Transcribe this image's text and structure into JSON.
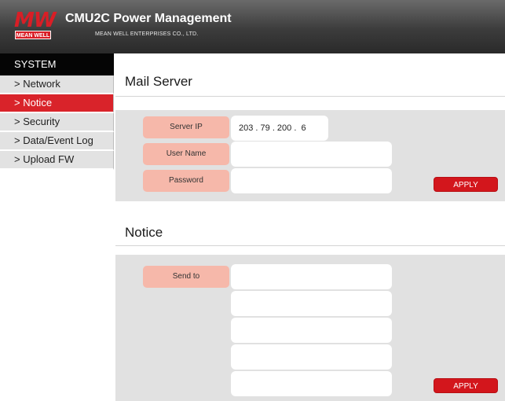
{
  "header": {
    "logo_mark": "MW",
    "logo_sub": "MEAN WELL",
    "title": "CMU2C Power Management",
    "company": "MEAN WELL ENTERPRISES CO., LTD."
  },
  "sidebar": {
    "heading": "SYSTEM",
    "items": [
      {
        "label": "> Network"
      },
      {
        "label": "> Notice"
      },
      {
        "label": "> Security"
      },
      {
        "label": "> Data/Event Log"
      },
      {
        "label": "> Upload FW"
      }
    ],
    "active_index": 1
  },
  "mail_server": {
    "title": "Mail Server",
    "server_ip_label": "Server IP",
    "server_ip_value": "203 . 79 . 200 .  6",
    "user_name_label": "User Name",
    "user_name_value": "",
    "password_label": "Password",
    "password_value": "",
    "apply_label": "APPLY"
  },
  "notice": {
    "title": "Notice",
    "send_to_label": "Send to",
    "send_to_values": [
      "",
      "",
      "",
      "",
      ""
    ],
    "apply_label": "APPLY"
  },
  "colors": {
    "accent_red": "#d9232a",
    "label_pink": "#f6b8aa",
    "panel_gray": "#e1e1e1",
    "header_dark": "#3c3c3c"
  }
}
